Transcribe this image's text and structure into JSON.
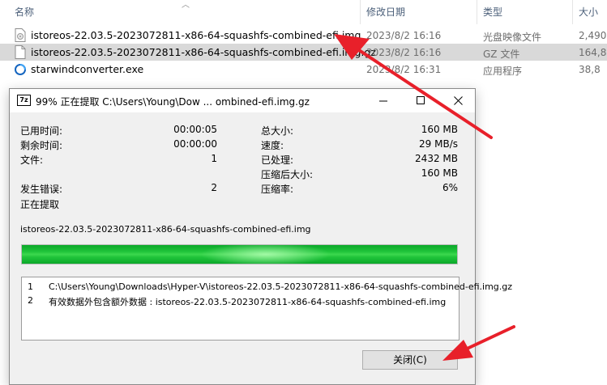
{
  "explorer": {
    "columns": {
      "name": "名称",
      "date": "修改日期",
      "type": "类型",
      "size": "大小"
    },
    "files": [
      {
        "icon": "disc-image-file-icon",
        "name": "istoreos-22.03.5-2023072811-x86-64-squashfs-combined-efi.img",
        "date": "2023/8/2 16:16",
        "type": "光盘映像文件",
        "size": "2,490"
      },
      {
        "icon": "generic-file-icon",
        "name": "istoreos-22.03.5-2023072811-x86-64-squashfs-combined-efi.img.gz",
        "date": "2023/8/2 16:16",
        "type": "GZ 文件",
        "size": "164,8"
      },
      {
        "icon": "starwind-app-icon",
        "name": "starwindconverter.exe",
        "date": "2023/8/2 16:31",
        "type": "应用程序",
        "size": "38,8"
      }
    ]
  },
  "dialog": {
    "app_icon_text": "7z",
    "title": "99% 正在提取 C:\\Users\\Young\\Dow ... ombined-efi.img.gz",
    "left_stats": [
      {
        "label": "已用时间:",
        "value": "00:00:05"
      },
      {
        "label": "剩余时间:",
        "value": "00:00:00"
      },
      {
        "label": "文件:",
        "value": "1"
      },
      {
        "label": "发生错误:",
        "value": "2"
      }
    ],
    "status": "正在提取",
    "right_stats": [
      {
        "label": "总大小:",
        "value": "160 MB"
      },
      {
        "label": "速度:",
        "value": "29 MB/s"
      },
      {
        "label": "已处理:",
        "value": "2432 MB"
      },
      {
        "label": "压缩后大小:",
        "value": "160 MB"
      },
      {
        "label": "压缩率:",
        "value": "6%"
      }
    ],
    "current_file": "istoreos-22.03.5-2023072811-x86-64-squashfs-combined-efi.img",
    "progress_fraction": 1.0,
    "log": [
      {
        "num": "1",
        "text": "C:\\Users\\Young\\Downloads\\Hyper-V\\istoreos-22.03.5-2023072811-x86-64-squashfs-combined-efi.img.gz"
      },
      {
        "num": "2",
        "text": "有效数据外包含额外数据 : istoreos-22.03.5-2023072811-x86-64-squashfs-combined-efi.img"
      }
    ],
    "close_label": "关闭(C)"
  },
  "colors": {
    "annotation_arrow": "#e8202a",
    "progress_green": "#1fc43a",
    "selected_row": "#d9d9d9"
  }
}
